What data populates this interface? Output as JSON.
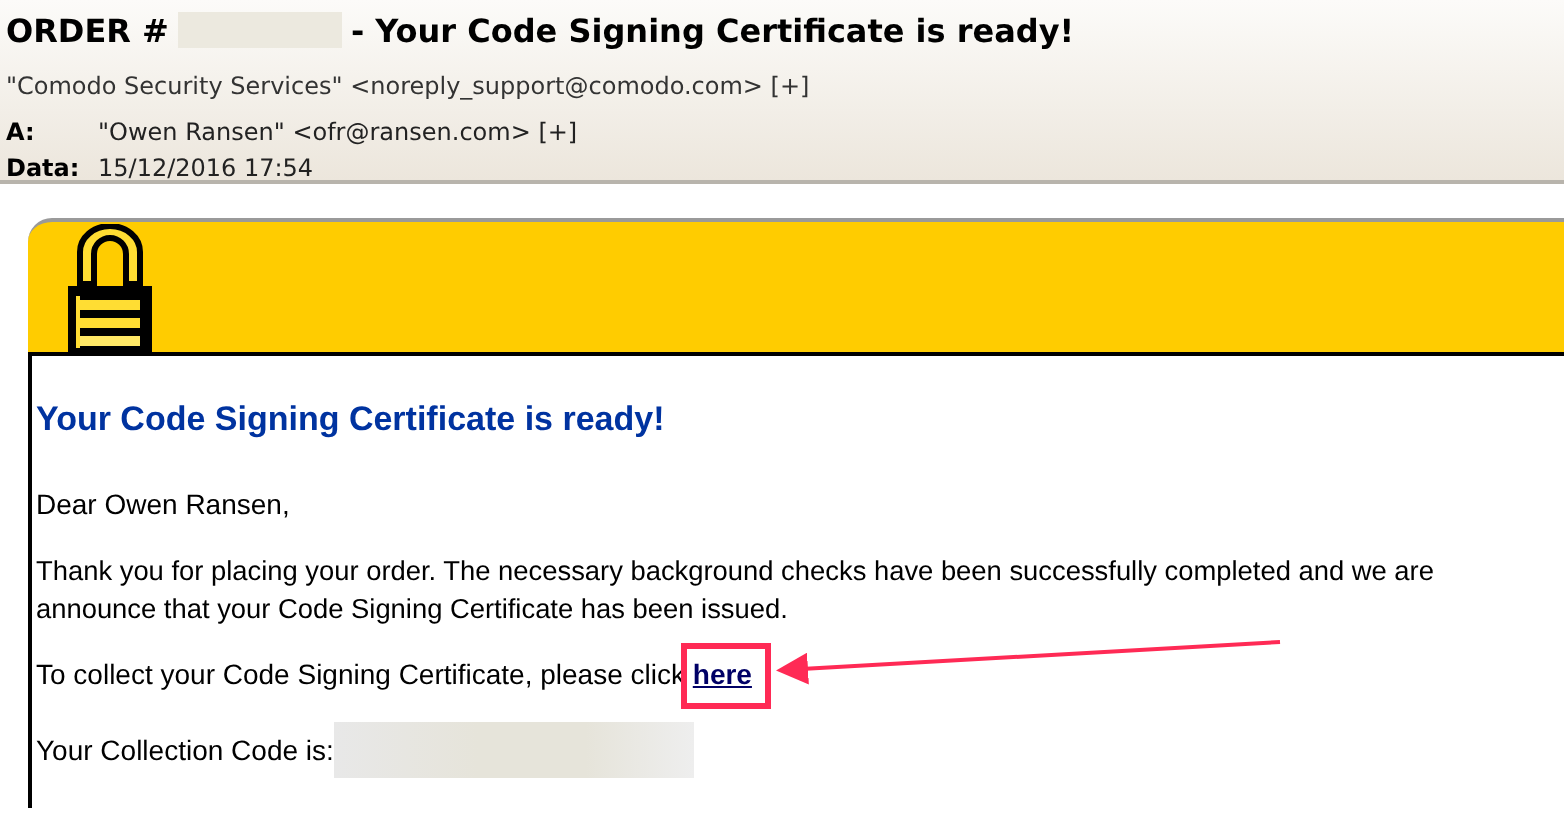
{
  "email": {
    "subject_prefix": "ORDER #",
    "subject": "- Your Code Signing Certificate is ready!",
    "from": "\"Comodo Security Services\" <noreply_support@comodo.com> [+]",
    "to_label": "A:",
    "to": "\"Owen Ransen\" <ofr@ransen.com> [+]",
    "date_label": "Data:",
    "date": "15/12/2016 17:54"
  },
  "body": {
    "heading": "Your Code Signing Certificate is ready!",
    "greeting": "Dear Owen Ransen,",
    "paragraph_lines": [
      "Thank you for placing your order. The necessary background checks have been successfully completed and we are",
      "announce that your Code Signing Certificate has been issued."
    ],
    "collect_text": "To collect your Code Signing Certificate, please click",
    "collect_link": "here",
    "code_label": "Your Collection Code is:"
  }
}
